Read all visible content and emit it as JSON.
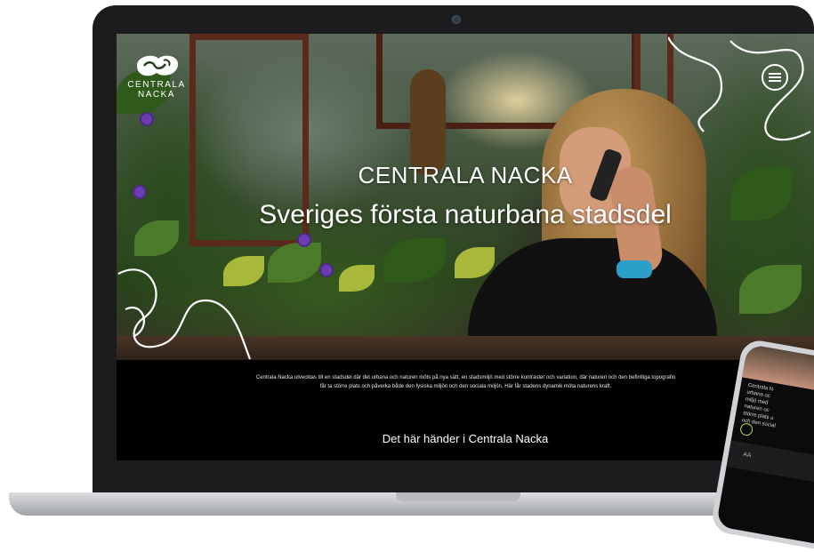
{
  "site": {
    "logo_text_line1": "CENTRALA",
    "logo_text_line2": "NACKA"
  },
  "hero": {
    "title": "CENTRALA NACKA",
    "subtitle": "Sveriges första naturbana stadsdel"
  },
  "intro": {
    "text": "Centrala Nacka utvecklas till en stadsdel där det urbana och naturen möts på nya sätt, en stadsmiljö med större kontraster och variation, där naturen och den befintliga topografin får ta större plats och påverka både den fysiska miljön och den sociala miljön. Här får stadens dynamik möta naturens kraft."
  },
  "section": {
    "heading": "Det här händer i Centrala Nacka"
  },
  "phone": {
    "text_lines": [
      "Centrala N",
      "urbana oc",
      "miljö med",
      "naturen oc",
      "större plats o",
      "och den social"
    ],
    "toolbar_label": "AA"
  },
  "icons": {
    "menu": "hamburger-menu-icon",
    "logo": "centrala-nacka-logo",
    "badge": "leaf-badge-icon"
  },
  "colors": {
    "accent_green": "#b8e05a",
    "background": "#000000",
    "text": "#ffffff"
  }
}
